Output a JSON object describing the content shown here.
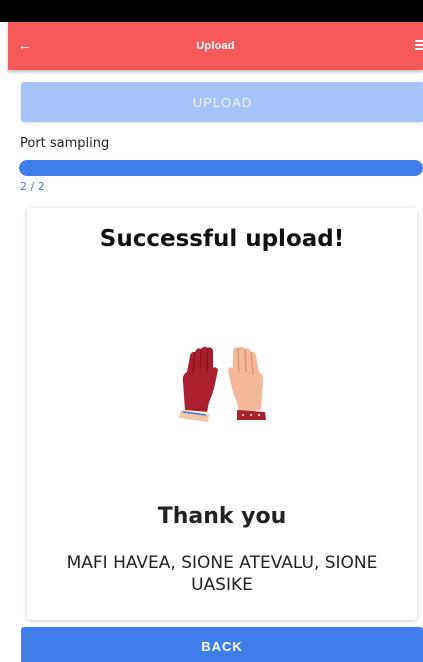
{
  "app_bar": {
    "title": "Upload",
    "back_icon": "arrow-left-icon",
    "menu_icon": "menu-icon",
    "color": "#f6595a"
  },
  "upload_button": {
    "label": "UPLOAD",
    "state": "disabled"
  },
  "progress": {
    "label": "Port sampling",
    "count_text": "2 / 2",
    "fraction": 1.0,
    "color": "#3f7de8"
  },
  "card": {
    "title": "Successful upload!",
    "image_icon": "high-five-hands-icon",
    "thank_you": "Thank you",
    "names": "MAFI HAVEA, SIONE ATEVALU, SIONE UASIKE"
  },
  "back_button": {
    "label": "BACK",
    "color": "#3f7de8"
  }
}
